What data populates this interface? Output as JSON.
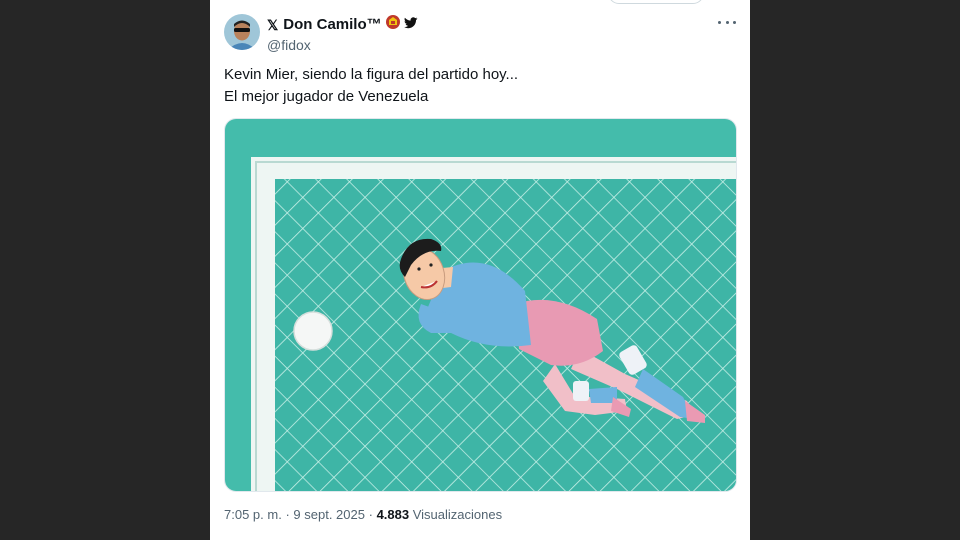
{
  "tweet": {
    "display_name": "Don Camilo™",
    "handle": "@fidox",
    "text_lines": [
      "Kevin Mier, siendo la figura del partido hoy...",
      "El mejor jugador de Venezuela"
    ],
    "time": "7:05 p. m.",
    "separator": "·",
    "date": "9 sept. 2025",
    "views_count": "4.883",
    "views_label": "Visualizaciones"
  },
  "icons": {
    "x_badge": "x-logo-icon",
    "flag_badge": "red-badge-icon",
    "bird_badge": "bird-icon",
    "more": "more-options-icon"
  },
  "colors": {
    "page_bg": "#262626",
    "card_bg": "#ffffff",
    "text_primary": "#0f1419",
    "text_secondary": "#536471",
    "pitch_teal": "#46bfae",
    "jersey_blue": "#6fb3e0",
    "shorts_pink": "#e89ab3"
  }
}
